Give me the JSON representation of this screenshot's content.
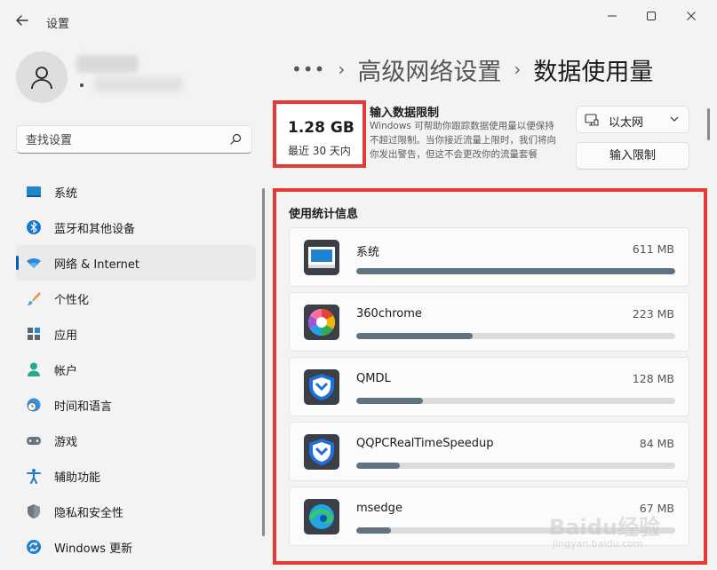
{
  "window": {
    "title": "设置",
    "minimize_icon": "minimize-icon",
    "maximize_icon": "maximize-icon",
    "close_icon": "close-icon"
  },
  "search": {
    "placeholder": "查找设置"
  },
  "sidebar": {
    "items": [
      {
        "label": "系统",
        "icon": "system-icon",
        "active": false
      },
      {
        "label": "蓝牙和其他设备",
        "icon": "bluetooth-icon",
        "active": false
      },
      {
        "label": "网络 & Internet",
        "icon": "wifi-icon",
        "active": true
      },
      {
        "label": "个性化",
        "icon": "brush-icon",
        "active": false
      },
      {
        "label": "应用",
        "icon": "apps-icon",
        "active": false
      },
      {
        "label": "帐户",
        "icon": "account-icon",
        "active": false
      },
      {
        "label": "时间和语言",
        "icon": "time-language-icon",
        "active": false
      },
      {
        "label": "游戏",
        "icon": "gamepad-icon",
        "active": false
      },
      {
        "label": "辅助功能",
        "icon": "accessibility-icon",
        "active": false
      },
      {
        "label": "隐私和安全性",
        "icon": "shield-icon",
        "active": false
      },
      {
        "label": "Windows 更新",
        "icon": "windows-update-icon",
        "active": false
      }
    ]
  },
  "breadcrumb": {
    "more": "•••",
    "separator": "›",
    "parent": "高级网络设置",
    "current": "数据使用量"
  },
  "summary": {
    "value": "1.28 GB",
    "period": "最近 30 天内"
  },
  "limit": {
    "title": "输入数据限制",
    "description": "Windows 可帮助你跟踪数据使用量以便保持不超过限制。当你接近流量上限时，我们将向你发出警告，但这不会更改你的流量套餐",
    "adapter_label": "以太网",
    "button_label": "输入限制"
  },
  "usage": {
    "heading": "使用统计信息",
    "apps": [
      {
        "name": "系统",
        "size": "611 MB",
        "fraction": 1.0,
        "icon": "system-app-icon"
      },
      {
        "name": "360chrome",
        "size": "223 MB",
        "fraction": 0.365,
        "icon": "360chrome-icon"
      },
      {
        "name": "QMDL",
        "size": "128 MB",
        "fraction": 0.21,
        "icon": "tencent-shield-icon"
      },
      {
        "name": "QQPCRealTimeSpeedup",
        "size": "84 MB",
        "fraction": 0.137,
        "icon": "tencent-shield-icon"
      },
      {
        "name": "msedge",
        "size": "67 MB",
        "fraction": 0.11,
        "icon": "edge-icon"
      }
    ]
  },
  "watermark": {
    "brand": "Baidu经验",
    "url": "jingyan.baidu.com"
  },
  "colors": {
    "accent": "#005fb8",
    "highlight_box": "#e53935",
    "bar_fill": "#5f7380",
    "bar_track": "#dcdcdc",
    "background": "#f3f3f3"
  }
}
